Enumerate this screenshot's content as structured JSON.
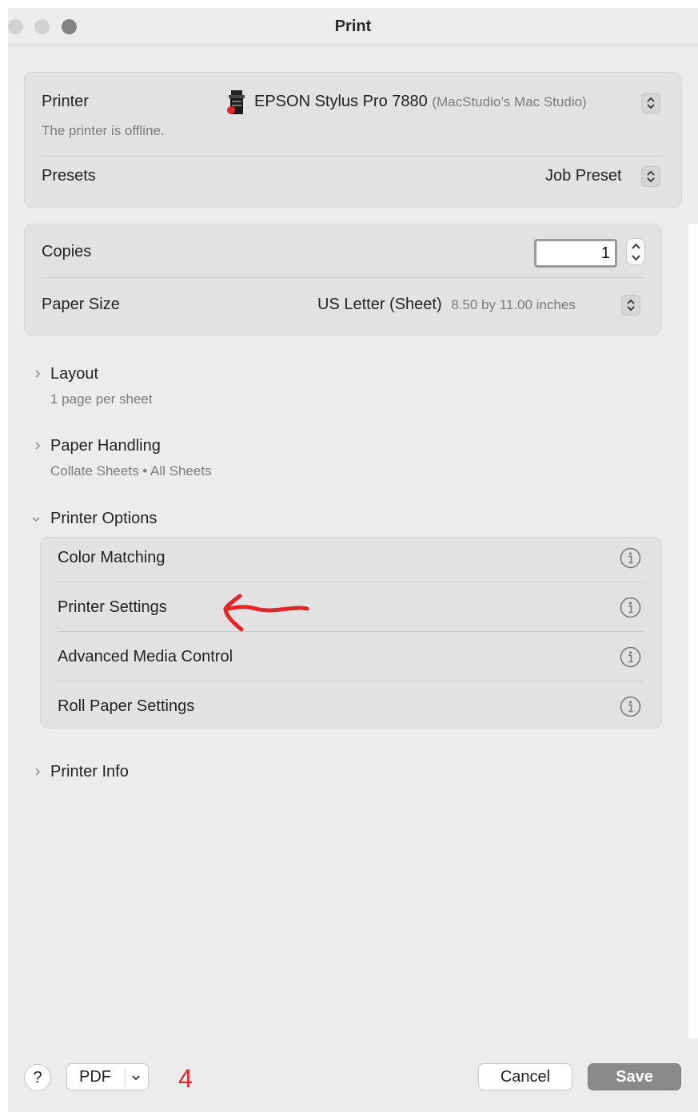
{
  "window": {
    "title": "Print"
  },
  "printer": {
    "label": "Printer",
    "name": "EPSON Stylus Pro 7880",
    "host": "(MacStudio’s Mac Studio)",
    "status": "The printer is offline."
  },
  "presets": {
    "label": "Presets",
    "value": "Job Preset"
  },
  "copies": {
    "label": "Copies",
    "value": "1"
  },
  "paper_size": {
    "label": "Paper Size",
    "value": "US Letter (Sheet)",
    "dimensions": "8.50 by 11.00 inches"
  },
  "sections": {
    "layout": {
      "label": "Layout",
      "summary": "1 page per sheet"
    },
    "paper_handling": {
      "label": "Paper Handling",
      "summary": "Collate Sheets • All Sheets"
    },
    "printer_options": {
      "label": "Printer Options",
      "items": [
        "Color Matching",
        "Printer Settings",
        "Advanced Media Control",
        "Roll Paper Settings"
      ]
    },
    "printer_info": {
      "label": "Printer Info"
    }
  },
  "footer": {
    "help_label": "?",
    "pdf_label": "PDF",
    "cancel_label": "Cancel",
    "save_label": "Save",
    "annotation_number": "4"
  },
  "colors": {
    "annotation_red": "#e3262a",
    "panel": "#e2e2e2",
    "background": "#ececec"
  }
}
